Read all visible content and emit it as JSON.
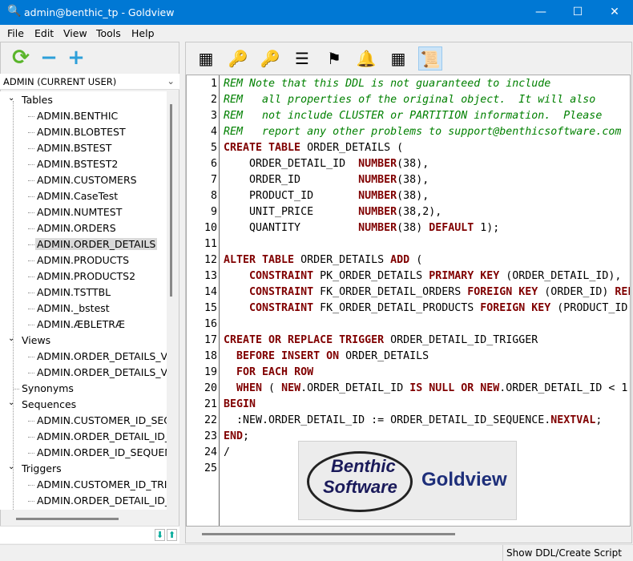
{
  "window": {
    "title": "admin@benthic_tp - Goldview",
    "icon": "magnifier-icon"
  },
  "menu": [
    "File",
    "Edit",
    "View",
    "Tools",
    "Help"
  ],
  "left_toolbar": [
    {
      "icon": "refresh-icon",
      "glyph": "⟳",
      "color": "#5ab52b"
    },
    {
      "icon": "minus-icon",
      "glyph": "−",
      "color": "#2d9fd9"
    },
    {
      "icon": "plus-icon",
      "glyph": "+",
      "color": "#2d9fd9"
    }
  ],
  "schema_select": {
    "value": "ADMIN (CURRENT USER)"
  },
  "tree": [
    {
      "label": "Tables",
      "level": 0,
      "expanded": true
    },
    {
      "label": "ADMIN.BENTHIC",
      "level": 1
    },
    {
      "label": "ADMIN.BLOBTEST",
      "level": 1
    },
    {
      "label": "ADMIN.BSTEST",
      "level": 1
    },
    {
      "label": "ADMIN.BSTEST2",
      "level": 1
    },
    {
      "label": "ADMIN.CUSTOMERS",
      "level": 1
    },
    {
      "label": "ADMIN.CaseTest",
      "level": 1
    },
    {
      "label": "ADMIN.NUMTEST",
      "level": 1
    },
    {
      "label": "ADMIN.ORDERS",
      "level": 1
    },
    {
      "label": "ADMIN.ORDER_DETAILS",
      "level": 1,
      "selected": true
    },
    {
      "label": "ADMIN.PRODUCTS",
      "level": 1
    },
    {
      "label": "ADMIN.PRODUCTS2",
      "level": 1
    },
    {
      "label": "ADMIN.TSTTBL",
      "level": 1
    },
    {
      "label": "ADMIN._bstest",
      "level": 1
    },
    {
      "label": "ADMIN.ÆBLETRÆ",
      "level": 1
    },
    {
      "label": "Views",
      "level": 0,
      "expanded": true
    },
    {
      "label": "ADMIN.ORDER_DETAILS_VIE",
      "level": 1
    },
    {
      "label": "ADMIN.ORDER_DETAILS_VIE",
      "level": 1
    },
    {
      "label": "Synonyms",
      "level": 0
    },
    {
      "label": "Sequences",
      "level": 0,
      "expanded": true
    },
    {
      "label": "ADMIN.CUSTOMER_ID_SEQ",
      "level": 1
    },
    {
      "label": "ADMIN.ORDER_DETAIL_ID_S",
      "level": 1
    },
    {
      "label": "ADMIN.ORDER_ID_SEQUEN",
      "level": 1
    },
    {
      "label": "Triggers",
      "level": 0,
      "expanded": true
    },
    {
      "label": "ADMIN.CUSTOMER_ID_TRIG",
      "level": 1
    },
    {
      "label": "ADMIN.ORDER_DETAIL_ID_T",
      "level": 1
    }
  ],
  "right_toolbar": [
    {
      "icon": "table-settings-icon",
      "glyph": "▦"
    },
    {
      "icon": "key-icon",
      "glyph": "🔑"
    },
    {
      "icon": "gray-key-icon",
      "glyph": "🔑"
    },
    {
      "icon": "numbered-list-icon",
      "glyph": "☰"
    },
    {
      "icon": "flag-icon",
      "glyph": "⚑"
    },
    {
      "icon": "bell-icon",
      "glyph": "🔔"
    },
    {
      "icon": "table-search-icon",
      "glyph": "▦"
    },
    {
      "icon": "script-icon",
      "glyph": "📜",
      "active": true
    }
  ],
  "code": [
    [
      [
        "cm",
        "REM Note that this DDL is not guaranteed to include"
      ]
    ],
    [
      [
        "cm",
        "REM   all properties of the original object.  It will also"
      ]
    ],
    [
      [
        "cm",
        "REM   not include CLUSTER or PARTITION information.  Please"
      ]
    ],
    [
      [
        "cm",
        "REM   report any other problems to support@benthicsoftware.com"
      ]
    ],
    [
      [
        "kw",
        "CREATE TABLE"
      ],
      [
        "t",
        " ORDER_DETAILS ("
      ]
    ],
    [
      [
        "t",
        "    ORDER_DETAIL_ID  "
      ],
      [
        "kw",
        "NUMBER"
      ],
      [
        "t",
        "(38),"
      ]
    ],
    [
      [
        "t",
        "    ORDER_ID         "
      ],
      [
        "kw",
        "NUMBER"
      ],
      [
        "t",
        "(38),"
      ]
    ],
    [
      [
        "t",
        "    PRODUCT_ID       "
      ],
      [
        "kw",
        "NUMBER"
      ],
      [
        "t",
        "(38),"
      ]
    ],
    [
      [
        "t",
        "    UNIT_PRICE       "
      ],
      [
        "kw",
        "NUMBER"
      ],
      [
        "t",
        "(38,2),"
      ]
    ],
    [
      [
        "t",
        "    QUANTITY         "
      ],
      [
        "kw",
        "NUMBER"
      ],
      [
        "t",
        "(38) "
      ],
      [
        "kw",
        "DEFAULT"
      ],
      [
        "t",
        " 1);"
      ]
    ],
    [],
    [
      [
        "kw",
        "ALTER TABLE"
      ],
      [
        "t",
        " ORDER_DETAILS "
      ],
      [
        "kw",
        "ADD"
      ],
      [
        "t",
        " ("
      ]
    ],
    [
      [
        "t",
        "    "
      ],
      [
        "kw",
        "CONSTRAINT"
      ],
      [
        "t",
        " PK_ORDER_DETAILS "
      ],
      [
        "kw",
        "PRIMARY KEY"
      ],
      [
        "t",
        " (ORDER_DETAIL_ID),"
      ]
    ],
    [
      [
        "t",
        "    "
      ],
      [
        "kw",
        "CONSTRAINT"
      ],
      [
        "t",
        " FK_ORDER_DETAIL_ORDERS "
      ],
      [
        "kw",
        "FOREIGN KEY"
      ],
      [
        "t",
        " (ORDER_ID) "
      ],
      [
        "kw",
        "REFERENCES"
      ]
    ],
    [
      [
        "t",
        "    "
      ],
      [
        "kw",
        "CONSTRAINT"
      ],
      [
        "t",
        " FK_ORDER_DETAIL_PRODUCTS "
      ],
      [
        "kw",
        "FOREIGN KEY"
      ],
      [
        "t",
        " (PRODUCT_ID"
      ]
    ],
    [],
    [
      [
        "kw",
        "CREATE OR REPLACE TRIGGER"
      ],
      [
        "t",
        " ORDER_DETAIL_ID_TRIGGER"
      ]
    ],
    [
      [
        "t",
        "  "
      ],
      [
        "kw",
        "BEFORE INSERT ON"
      ],
      [
        "t",
        " ORDER_DETAILS"
      ]
    ],
    [
      [
        "t",
        "  "
      ],
      [
        "kw",
        "FOR EACH ROW"
      ]
    ],
    [
      [
        "t",
        "  "
      ],
      [
        "kw",
        "WHEN"
      ],
      [
        "t",
        " ( "
      ],
      [
        "kw",
        "NEW"
      ],
      [
        "t",
        ".ORDER_DETAIL_ID "
      ],
      [
        "kw",
        "IS NULL OR NEW"
      ],
      [
        "t",
        ".ORDER_DETAIL_ID < 1"
      ]
    ],
    [
      [
        "kw",
        "BEGIN"
      ]
    ],
    [
      [
        "t",
        "  :NEW.ORDER_DETAIL_ID := ORDER_DETAIL_ID_SEQUENCE."
      ],
      [
        "kw",
        "NEXTVAL"
      ],
      [
        "t",
        ";"
      ]
    ],
    [
      [
        "kw",
        "END"
      ],
      [
        "t",
        ";"
      ]
    ],
    [
      [
        "t",
        "/"
      ]
    ],
    []
  ],
  "logo": {
    "line1": "Benthic",
    "line2": "Software",
    "product": "Goldview"
  },
  "status": {
    "text": "Show DDL/Create Script"
  },
  "colors": {
    "titlebar": "#0078d4",
    "keyword": "#800000",
    "comment": "#008000"
  }
}
